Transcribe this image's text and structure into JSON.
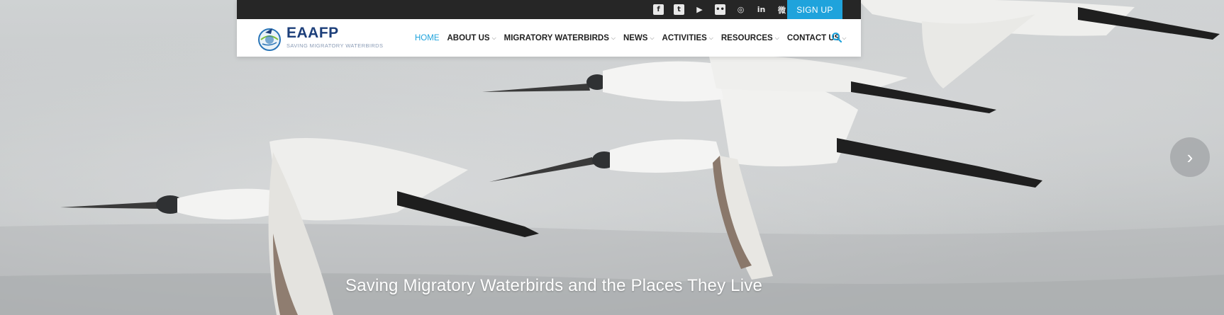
{
  "topbar": {
    "social_icons": [
      {
        "name": "facebook-icon",
        "glyph": "f"
      },
      {
        "name": "twitter-icon",
        "glyph": "t"
      },
      {
        "name": "youtube-icon",
        "glyph": "▶"
      },
      {
        "name": "flickr-icon",
        "glyph": "••"
      },
      {
        "name": "instagram-icon",
        "glyph": "◎"
      },
      {
        "name": "linkedin-icon",
        "glyph": "in"
      },
      {
        "name": "weibo-icon",
        "glyph": "微"
      }
    ],
    "signup_label": "SIGN UP"
  },
  "logo": {
    "text": "EAAFP",
    "subtitle": "SAVING MIGRATORY WATERBIRDS"
  },
  "nav": {
    "items": [
      {
        "label": "HOME",
        "active": true,
        "dropdown": false
      },
      {
        "label": "ABOUT US",
        "active": false,
        "dropdown": true
      },
      {
        "label": "MIGRATORY WATERBIRDS",
        "active": false,
        "dropdown": true
      },
      {
        "label": "NEWS",
        "active": false,
        "dropdown": true
      },
      {
        "label": "ACTIVITIES",
        "active": false,
        "dropdown": true
      },
      {
        "label": "RESOURCES",
        "active": false,
        "dropdown": true
      },
      {
        "label": "CONTACT US",
        "active": false,
        "dropdown": true
      }
    ],
    "search_icon": "search-icon"
  },
  "hero": {
    "caption": "Saving Migratory Waterbirds and the Places They Live",
    "next_icon": "chevron-right-icon"
  },
  "colors": {
    "accent": "#1fa3dc",
    "topbar": "#262626",
    "logo_text": "#1d3f7a"
  }
}
